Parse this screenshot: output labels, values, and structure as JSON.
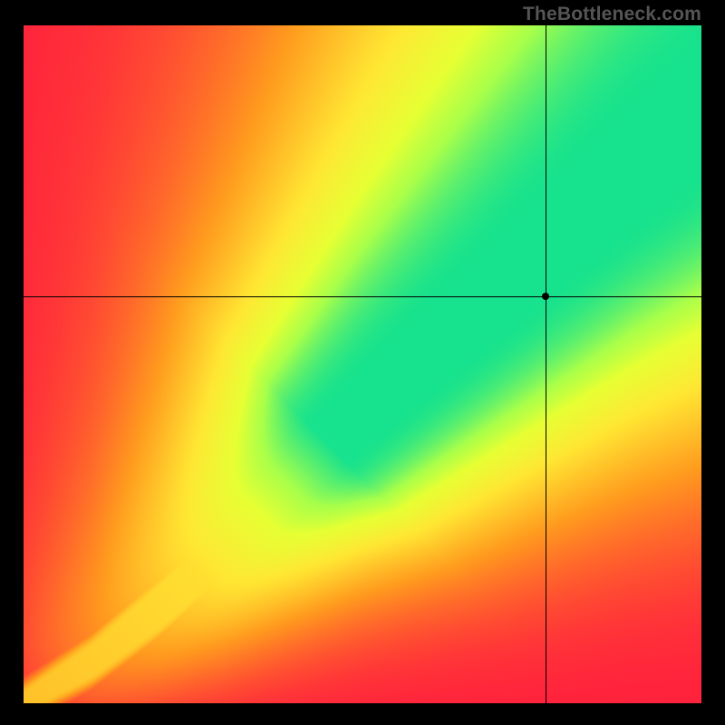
{
  "watermark": "TheBottleneck.com",
  "chart_data": {
    "type": "heatmap",
    "title": "",
    "xlabel": "",
    "ylabel": "",
    "xlim": [
      0,
      100
    ],
    "ylim": [
      0,
      100
    ],
    "crosshair": {
      "x": 77,
      "y": 60
    },
    "colormap": [
      {
        "t": 0.0,
        "color": "#ff1f3d"
      },
      {
        "t": 0.42,
        "color": "#ff9b1e"
      },
      {
        "t": 0.68,
        "color": "#ffe733"
      },
      {
        "t": 0.82,
        "color": "#e7ff33"
      },
      {
        "t": 0.9,
        "color": "#a8ff4a"
      },
      {
        "t": 1.0,
        "color": "#17e28d"
      }
    ],
    "ridge": {
      "description": "Optimal-match curve (green band) running diagonally; slight upward bow near origin.",
      "points": [
        {
          "x": 0,
          "y": 0
        },
        {
          "x": 10,
          "y": 6
        },
        {
          "x": 20,
          "y": 14
        },
        {
          "x": 30,
          "y": 23
        },
        {
          "x": 40,
          "y": 33
        },
        {
          "x": 50,
          "y": 43
        },
        {
          "x": 60,
          "y": 52
        },
        {
          "x": 70,
          "y": 61
        },
        {
          "x": 80,
          "y": 70
        },
        {
          "x": 90,
          "y": 79
        },
        {
          "x": 100,
          "y": 87
        }
      ],
      "green_band_halfwidth_start": 1.2,
      "green_band_halfwidth_end": 9.0
    }
  }
}
